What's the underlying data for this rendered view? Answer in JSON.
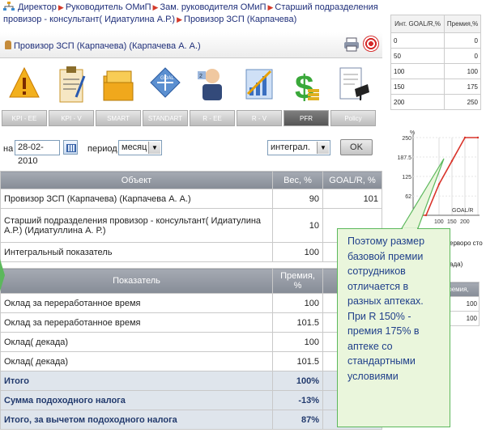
{
  "breadcrumb": {
    "items": [
      "Директор",
      "Руководитель ОМиП",
      "Зам. руководителя ОМиП",
      "Старший подразделения провизор - консультант( Идиатулина А.Р.)",
      "Провизор ЗСП (Карпачева)"
    ]
  },
  "header": {
    "user": "Провизор ЗСП (Карпачева)  (Карпачева А. А.)"
  },
  "modules": [
    {
      "label": "KPI - EE",
      "icon": "warning-sign-icon"
    },
    {
      "label": "KPI - V",
      "icon": "clipboard-icon"
    },
    {
      "label": "SMART",
      "icon": "folders-icon"
    },
    {
      "label": "STANDART",
      "icon": "goal-tile-icon"
    },
    {
      "label": "R - EE",
      "icon": "manager-icon"
    },
    {
      "label": "R - V",
      "icon": "growth-chart-icon"
    },
    {
      "label": "PFR",
      "icon": "dollar-icon",
      "active": true
    },
    {
      "label": "Policy",
      "icon": "document-cap-icon"
    }
  ],
  "filters": {
    "date_label": "на",
    "date_value": "28-02-2010",
    "period_label": "период",
    "period_value": "месяц",
    "mode_value": "интеграл.",
    "ok_label": "OK"
  },
  "objects_table": {
    "headers": [
      "Объект",
      "Вес, %",
      "GOAL/R, %"
    ],
    "rows": [
      {
        "name": "Провизор ЗСП (Карпачева) (Карпачева А. А.)",
        "weight": "90",
        "goal": "101"
      },
      {
        "name": "Старший подразделения провизор - консультант( Идиатулина А.Р.) (Идиатуллина А. Р.)",
        "weight": "10",
        "goal": ""
      },
      {
        "name": "Интегральный показатель",
        "weight": "100",
        "goal": ""
      }
    ]
  },
  "indicators_table": {
    "headers": [
      "Показатель",
      "Премия, %",
      "Пре"
    ],
    "rows": [
      {
        "name": "Оклад за переработанное время",
        "value": "100",
        "bold": false
      },
      {
        "name": "Оклад за переработанное время",
        "value": "101.5",
        "bold": false
      },
      {
        "name": "Оклад( декада)",
        "value": "100",
        "bold": false
      },
      {
        "name": "Оклад( декада)",
        "value": "101.5",
        "bold": false
      },
      {
        "name": "Итого",
        "value": "100%",
        "bold": true
      },
      {
        "name": "Сумма подоходного налога",
        "value": "-13%",
        "bold": true
      },
      {
        "name": "Итого, за вычетом подоходного налога",
        "value": "87%",
        "bold": true
      }
    ]
  },
  "side_table": {
    "headers": [
      "Инт. GOAL/R,%",
      "Премия,%"
    ],
    "rows": [
      [
        "0",
        "0"
      ],
      [
        "50",
        "0"
      ],
      [
        "100",
        "100"
      ],
      [
        "150",
        "175"
      ],
      [
        "200",
        "250"
      ]
    ]
  },
  "chart_data": {
    "type": "line",
    "x": [
      0,
      50,
      100,
      150,
      200,
      250
    ],
    "series": [
      {
        "values": [
          0,
          0,
          100,
          175,
          250,
          250
        ]
      }
    ],
    "ylabel": "%",
    "xlabel": "GOAL/R",
    "y_ticks": [
      "62",
      "125",
      "187.5",
      "250"
    ],
    "x_ticks": [
      "100",
      "150",
      "200"
    ],
    "color": "#d9342b"
  },
  "side_fragments": {
    "text1": "ерворо сто",
    "text2": "ада)",
    "mini_header": "ремия,",
    "mini_values": [
      "100",
      "100"
    ]
  },
  "callout": {
    "text": "Поэтому размер базовой премии сотрудников отличается в разных аптеках. При R 150% - премия 175% в аптеке со стандартными условиями"
  },
  "colors": {
    "callout_bg": "#eaf6dc",
    "callout_border": "#5cb85c",
    "callout_text": "#1f3f8a",
    "header_blue": "#1f2f7a"
  }
}
